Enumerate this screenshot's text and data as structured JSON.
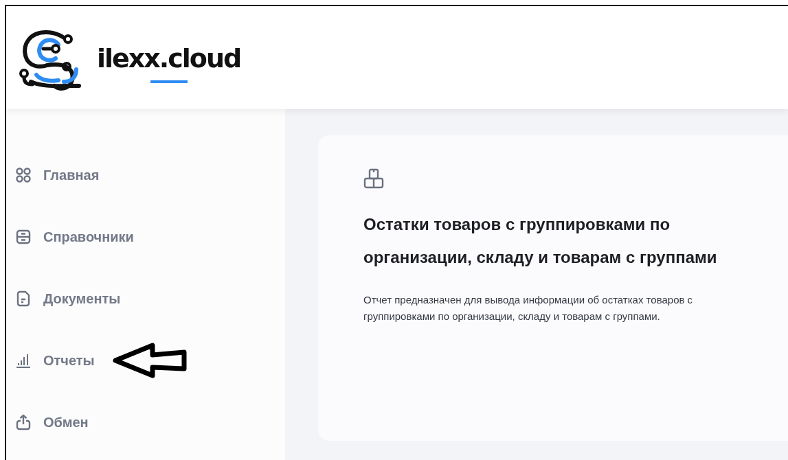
{
  "header": {
    "logo_text": "ilexx.cloud"
  },
  "sidebar": {
    "items": [
      {
        "label": "Главная"
      },
      {
        "label": "Справочники"
      },
      {
        "label": "Документы"
      },
      {
        "label": "Отчеты"
      },
      {
        "label": "Обмен"
      }
    ]
  },
  "card": {
    "title": "Остатки товаров с группировками по организации, складу и товарам с группами",
    "description": "Отчет предназначен для вывода информации об остатках товаров с группировками по организации, складу и товарам с группами."
  }
}
